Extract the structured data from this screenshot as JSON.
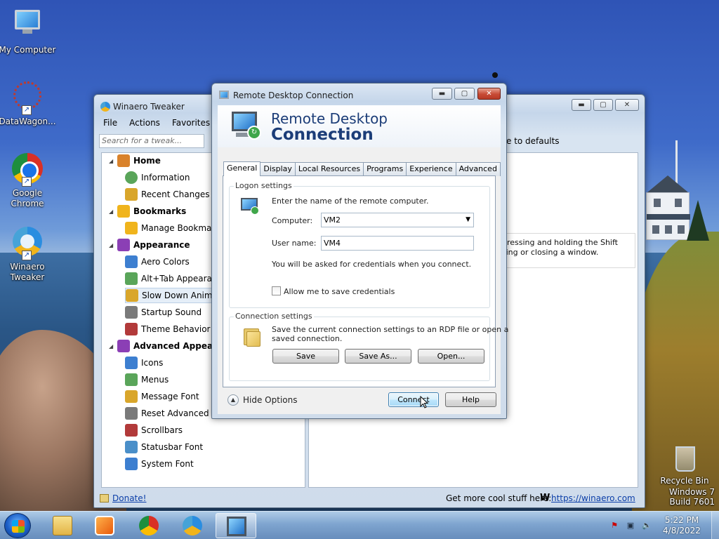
{
  "desktop": {
    "icons": [
      {
        "label": "My Computer"
      },
      {
        "label": "DataWagon..."
      },
      {
        "label": "Google Chrome"
      },
      {
        "label": "Winaero Tweaker"
      },
      {
        "label": "Recycle Bin"
      }
    ],
    "watermark": {
      "line1": "Windows 7",
      "line2": "Build 7601"
    }
  },
  "tweaker": {
    "title": "Winaero Tweaker",
    "menu": [
      "File",
      "Actions",
      "Favorites"
    ],
    "search_placeholder": "Search for a tweak...",
    "reset_label": "e to defaults",
    "tree": [
      {
        "label": "Home",
        "cat": true,
        "icon": "home-icon"
      },
      {
        "label": "Information",
        "icon": "info-icon"
      },
      {
        "label": "Recent Changes",
        "icon": "recent-changes-icon"
      },
      {
        "label": "Bookmarks",
        "cat": true,
        "icon": "star-icon"
      },
      {
        "label": "Manage Bookmarks",
        "icon": "star-icon"
      },
      {
        "label": "Appearance",
        "cat": true,
        "icon": "palette-icon"
      },
      {
        "label": "Aero Colors",
        "icon": "aero-colors-icon"
      },
      {
        "label": "Alt+Tab Appearance",
        "icon": "alt-tab-icon"
      },
      {
        "label": "Slow Down Animations",
        "icon": "animation-icon",
        "selected": true
      },
      {
        "label": "Startup Sound",
        "icon": "speaker-icon"
      },
      {
        "label": "Theme Behavior",
        "icon": "theme-icon"
      },
      {
        "label": "Advanced Appearance",
        "cat": true,
        "icon": "palette-icon"
      },
      {
        "label": "Icons",
        "icon": "icons-icon"
      },
      {
        "label": "Menus",
        "icon": "menus-icon"
      },
      {
        "label": "Message Font",
        "icon": "warning-icon"
      },
      {
        "label": "Reset Advanced Appearance",
        "icon": "reset-icon"
      },
      {
        "label": "Scrollbars",
        "icon": "scrollbars-icon"
      },
      {
        "label": "Statusbar Font",
        "icon": "statusbar-font-icon"
      },
      {
        "label": "System Font",
        "icon": "font-icon"
      }
    ],
    "description": {
      "line1": "by pressing and holding the Shift",
      "line2": "imizing or closing a window."
    },
    "status": {
      "donate": "Donate!",
      "more": "Get more cool stuff here:",
      "w_glyph": "W",
      "url": "https://winaero.com"
    }
  },
  "rdc": {
    "title": "Remote Desktop Connection",
    "header_line1": "Remote Desktop",
    "header_line2": "Connection",
    "tabs": [
      "General",
      "Display",
      "Local Resources",
      "Programs",
      "Experience",
      "Advanced"
    ],
    "logon": {
      "group_label": "Logon settings",
      "prompt": "Enter the name of the remote computer.",
      "computer_label": "Computer:",
      "computer_value": "VM2",
      "user_label": "User name:",
      "user_value": "VM4",
      "credentials_note": "You will be asked for credentials when you connect.",
      "save_credentials_label": "Allow me to save credentials",
      "save_credentials_checked": false
    },
    "connection": {
      "group_label": "Connection settings",
      "desc_line1": "Save the current connection settings to an RDP file or open a",
      "desc_line2": "saved connection.",
      "save": "Save",
      "save_as": "Save As...",
      "open": "Open..."
    },
    "hide_options": "Hide Options",
    "connect": "Connect",
    "help": "Help"
  },
  "taskbar": {
    "time": "5:22 PM",
    "date": "4/8/2022",
    "pinned": [
      "explorer-icon",
      "media-player-icon",
      "chrome-icon",
      "winaero-tweaker-icon",
      "remote-desktop-icon"
    ],
    "active_index": 4
  }
}
